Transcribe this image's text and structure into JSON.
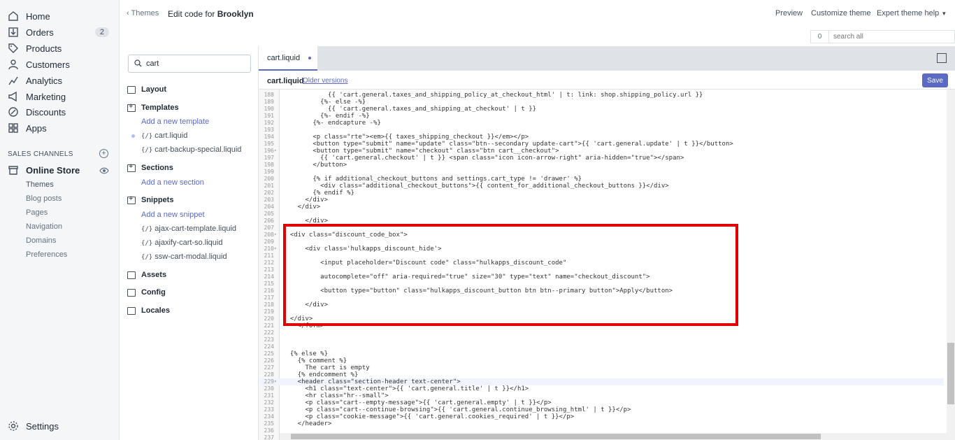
{
  "nav": {
    "items": [
      {
        "label": "Home",
        "icon": "home-icon"
      },
      {
        "label": "Orders",
        "icon": "orders-icon",
        "badge": "2"
      },
      {
        "label": "Products",
        "icon": "tag-icon"
      },
      {
        "label": "Customers",
        "icon": "person-icon"
      },
      {
        "label": "Analytics",
        "icon": "chart-icon"
      },
      {
        "label": "Marketing",
        "icon": "megaphone-icon"
      },
      {
        "label": "Discounts",
        "icon": "discount-icon"
      },
      {
        "label": "Apps",
        "icon": "apps-icon"
      }
    ],
    "sales_channels_label": "SALES CHANNELS",
    "online_store": "Online Store",
    "sub_items": [
      "Themes",
      "Blog posts",
      "Pages",
      "Navigation",
      "Domains",
      "Preferences"
    ],
    "settings": "Settings"
  },
  "topbar": {
    "back": "Themes",
    "title_prefix": "Edit code for",
    "title_theme": "Brooklyn",
    "preview": "Preview",
    "customize": "Customize theme",
    "expert": "Expert theme help",
    "search_count": "0",
    "search_placeholder": "search all"
  },
  "tree": {
    "search_value": "cart",
    "layout": "Layout",
    "templates": "Templates",
    "add_template": "Add a new template",
    "template_files": [
      "cart.liquid",
      "cart-backup-special.liquid"
    ],
    "sections": "Sections",
    "add_section": "Add a new section",
    "snippets": "Snippets",
    "add_snippet": "Add a new snippet",
    "snippet_files": [
      "ajax-cart-template.liquid",
      "ajaxify-cart-so.liquid",
      "ssw-cart-modal.liquid"
    ],
    "assets": "Assets",
    "config": "Config",
    "locales": "Locales"
  },
  "editor": {
    "tab": "cart.liquid",
    "file": "cart.liquid",
    "older": "Older versions",
    "save": "Save",
    "lines": [
      {
        "n": "188",
        "t": "            {{ 'cart.general.taxes_and_shipping_policy_at_checkout_html' | t: link: shop.shipping_policy.url }}"
      },
      {
        "n": "189",
        "t": "          {%- else -%}"
      },
      {
        "n": "190",
        "t": "            {{ 'cart.general.taxes_and_shipping_at_checkout' | t }}"
      },
      {
        "n": "191",
        "t": "          {%- endif -%}"
      },
      {
        "n": "192",
        "t": "        {%- endcapture -%}"
      },
      {
        "n": "193",
        "t": ""
      },
      {
        "n": "194",
        "t": "        <p class=\"rte\"><em>{{ taxes_shipping_checkout }}</em></p>"
      },
      {
        "n": "195",
        "t": "        <button type=\"submit\" name=\"update\" class=\"btn--secondary update-cart\">{{ 'cart.general.update' | t }}</button>"
      },
      {
        "n": "196",
        "t": "        <button type=\"submit\" name=\"checkout\" class=\"btn cart__checkout\">",
        "f": true
      },
      {
        "n": "197",
        "t": "          {{ 'cart.general.checkout' | t }} <span class=\"icon icon-arrow-right\" aria-hidden=\"true\"></span>"
      },
      {
        "n": "198",
        "t": "        </button>"
      },
      {
        "n": "199",
        "t": ""
      },
      {
        "n": "200",
        "t": "        {% if additional_checkout_buttons and settings.cart_type != 'drawer' %}"
      },
      {
        "n": "201",
        "t": "          <div class=\"additional_checkout_buttons\">{{ content_for_additional_checkout_buttons }}</div>"
      },
      {
        "n": "202",
        "t": "        {% endif %}"
      },
      {
        "n": "203",
        "t": "      </div>"
      },
      {
        "n": "204",
        "t": "    </div>"
      },
      {
        "n": "205",
        "t": ""
      },
      {
        "n": "206",
        "t": "      </div>"
      },
      {
        "n": "207",
        "t": ""
      },
      {
        "n": "208",
        "t": "  <div class=\"discount_code_box\">",
        "f": true
      },
      {
        "n": "209",
        "t": ""
      },
      {
        "n": "210",
        "t": "      <div class='hulkapps_discount_hide'>",
        "f": true
      },
      {
        "n": "211",
        "t": ""
      },
      {
        "n": "212",
        "t": "          <input placeholder=\"Discount code\" class=\"hulkapps_discount_code\""
      },
      {
        "n": "213",
        "t": ""
      },
      {
        "n": "214",
        "t": "          autocomplete=\"off\" aria-required=\"true\" size=\"30\" type=\"text\" name=\"checkout_discount\">"
      },
      {
        "n": "215",
        "t": ""
      },
      {
        "n": "216",
        "t": "          <button type=\"button\" class=\"hulkapps_discount_button btn btn--primary button\">Apply</button>"
      },
      {
        "n": "217",
        "t": ""
      },
      {
        "n": "218",
        "t": "      </div>"
      },
      {
        "n": "219",
        "t": ""
      },
      {
        "n": "220",
        "t": "  </div>"
      },
      {
        "n": "221",
        "t": "    </form>"
      },
      {
        "n": "222",
        "t": ""
      },
      {
        "n": "223",
        "t": ""
      },
      {
        "n": "224",
        "t": ""
      },
      {
        "n": "225",
        "t": "  {% else %}"
      },
      {
        "n": "226",
        "t": "    {% comment %}"
      },
      {
        "n": "227",
        "t": "      The cart is empty"
      },
      {
        "n": "228",
        "t": "    {% endcomment %}"
      },
      {
        "n": "229",
        "t": "    <header class=\"section-header text-center\">",
        "f": true
      },
      {
        "n": "230",
        "t": "      <h1 class=\"text-center\">{{ 'cart.general.title' | t }}</h1>"
      },
      {
        "n": "231",
        "t": "      <hr class=\"hr--small\">"
      },
      {
        "n": "232",
        "t": "      <p class=\"cart--empty-message\">{{ 'cart.general.empty' | t }}</p>"
      },
      {
        "n": "233",
        "t": "      <p class=\"cart--continue-browsing\">{{ 'cart.general.continue_browsing_html' | t }}</p>"
      },
      {
        "n": "234",
        "t": "      <p class=\"cookie-message\">{{ 'cart.general.cookies_required' | t }}</p>"
      },
      {
        "n": "235",
        "t": "    </header>"
      },
      {
        "n": "236",
        "t": ""
      },
      {
        "n": "237",
        "t": ""
      }
    ]
  }
}
